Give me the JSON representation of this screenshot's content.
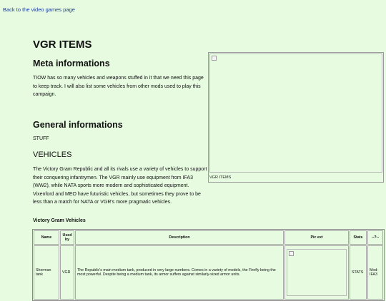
{
  "nav": {
    "back_link": "Back to the video games page"
  },
  "page": {
    "title": "VGR ITEMS"
  },
  "meta": {
    "heading": "Meta informations",
    "text": "TIOW has so many vehicles and weapons stuffed in it that we need this page to keep track. I will also list some vehicles from other mods used to play this campaign."
  },
  "general": {
    "heading": "General informations",
    "text": "STUFF"
  },
  "vehicles": {
    "heading": "VEHICLES",
    "text": "The Victory Gram Republic and all its rivals use a variety of vehicles to support their conquering infantrymen. The VGR mainly use equipment from IFA3 (WW2), while NATA sports more modern and sophisticated equipment. Vixenford and MEO have futuristic vehicles, but sometimes they prove to be less than a match for NATA or VGR's more pragmatic vehicles."
  },
  "infobox": {
    "caption": "VGR ITEMS"
  },
  "table": {
    "heading": "Victory Gram Vehicles",
    "columns": [
      "Name",
      "Used by",
      "Description",
      "Pic ext",
      "Stats",
      "--?--"
    ],
    "rows": [
      {
        "name": "Sherman tank",
        "used_by": "VGR",
        "description": "The Republic's main medium tank, produced in very large numbers. Comes in a variety of models, the Firefly being the most powerful. Despite being a medium tank, its armor suffers against similarly-sized armor units.",
        "stats": "STATS",
        "extra": "Mod: IFA3"
      }
    ]
  }
}
